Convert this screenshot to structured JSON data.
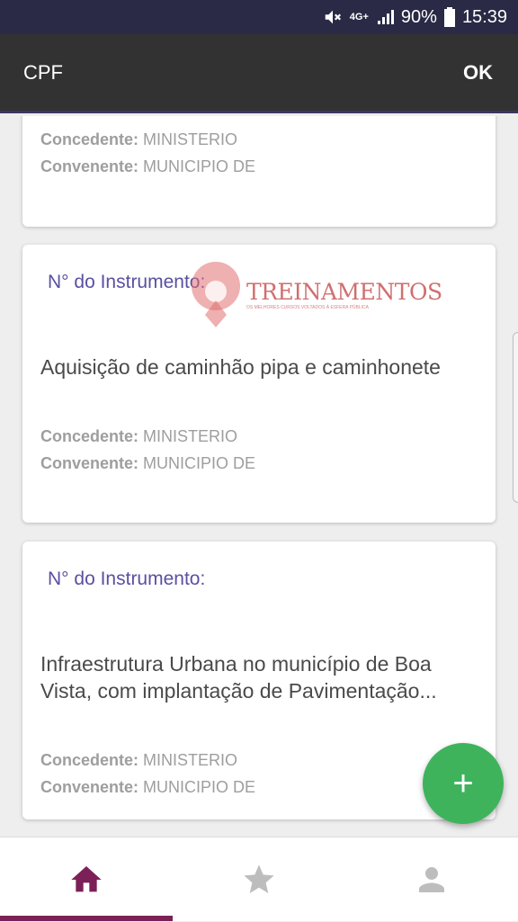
{
  "status_bar": {
    "network": "4G+",
    "battery": "90%",
    "time": "15:39"
  },
  "app_bar": {
    "title": "CPF",
    "action": "OK"
  },
  "cards": [
    {
      "concedente_label": "Concedente:",
      "concedente_value": "MINISTERIO",
      "convenente_label": "Convenente:",
      "convenente_value": "MUNICIPIO DE"
    },
    {
      "instrument_label": "N° do Instrumento:",
      "title": "Aquisição de caminhão pipa e caminhonete",
      "concedente_label": "Concedente:",
      "concedente_value": "MINISTERIO",
      "convenente_label": "Convenente:",
      "convenente_value": "MUNICIPIO DE"
    },
    {
      "instrument_label": "N° do Instrumento:",
      "title": "Infraestrutura Urbana no município de Boa Vista, com implantação de Pavimentação...",
      "concedente_label": "Concedente:",
      "concedente_value": "MINISTERIO",
      "convenente_label": "Convenente:",
      "convenente_value": "MUNICIPIO DE"
    }
  ],
  "watermark": {
    "name": "TREINAMENTOS",
    "tagline": "OS MELHORES CURSOS VOLTADOS À ESFERA PÚBLICA"
  },
  "fab": {
    "label": "+"
  },
  "colors": {
    "status_bar": "#2a2a46",
    "app_bar": "#323232",
    "instrument_text": "#5a4fa2",
    "fab": "#3fb35c",
    "nav_active": "#7b2157",
    "nav_inactive": "#bdbdbd"
  },
  "icons": {
    "home": "home-icon",
    "favorites": "star-icon",
    "profile": "person-icon"
  }
}
